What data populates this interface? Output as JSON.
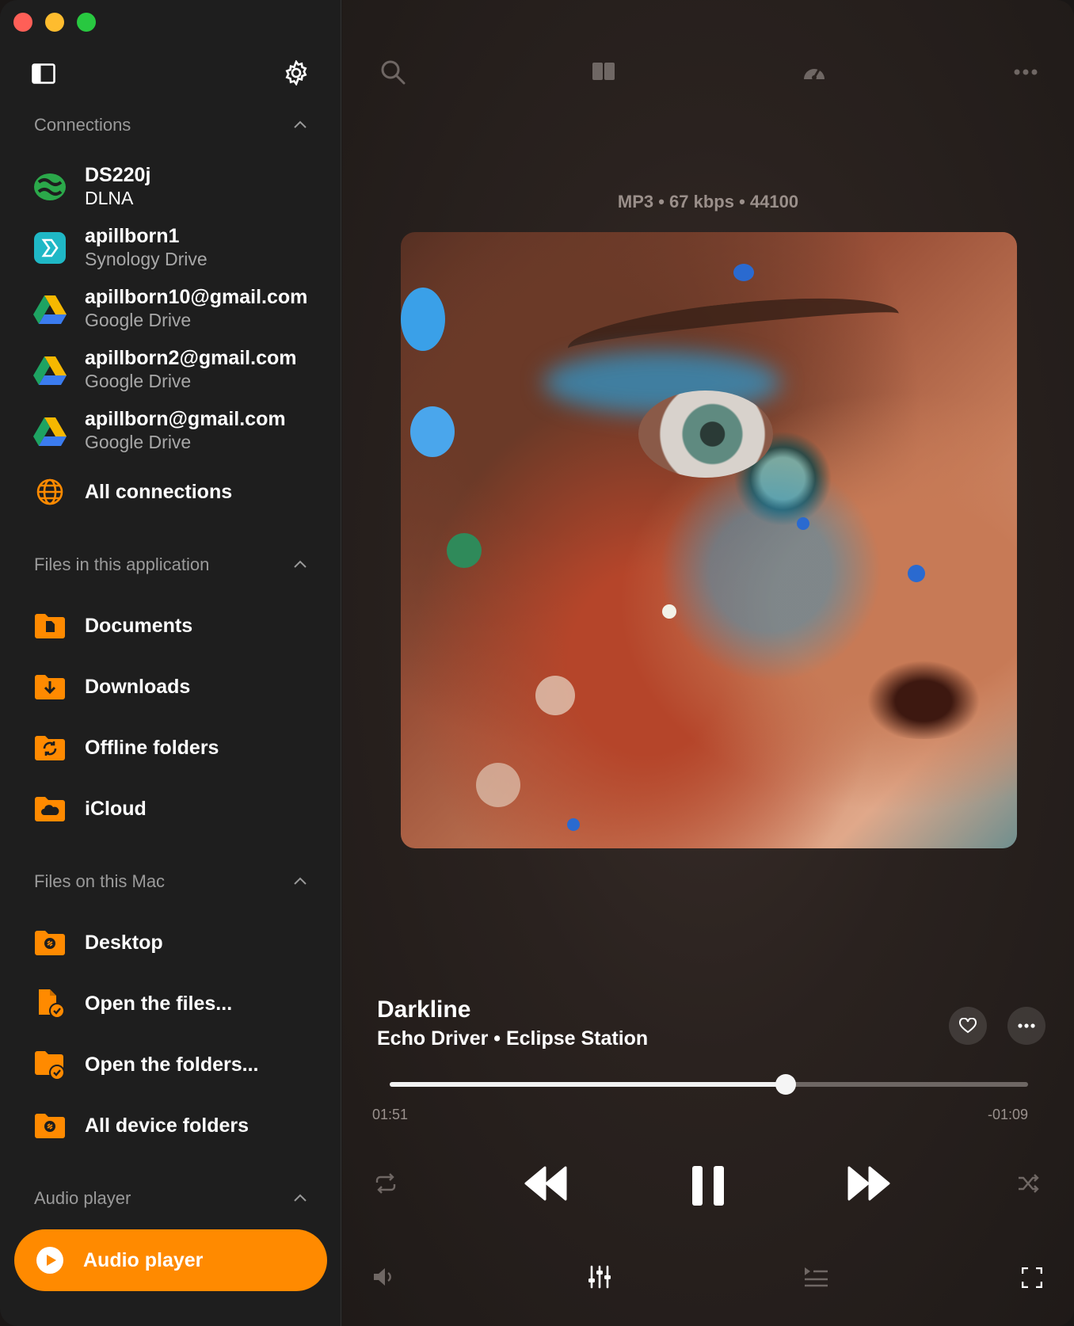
{
  "sidebar": {
    "sections": {
      "connections": "Connections",
      "files_app": "Files in this application",
      "files_mac": "Files on this Mac",
      "audio_player": "Audio player"
    },
    "connections": [
      {
        "title": "DS220j",
        "subtitle": "DLNA",
        "icon": "dlna-icon"
      },
      {
        "title": "apillborn1",
        "subtitle": "Synology Drive",
        "icon": "synology-drive-icon"
      },
      {
        "title": "apillborn10@gmail.com",
        "subtitle": "Google Drive",
        "icon": "google-drive-icon"
      },
      {
        "title": "apillborn2@gmail.com",
        "subtitle": "Google Drive",
        "icon": "google-drive-icon"
      },
      {
        "title": "apillborn@gmail.com",
        "subtitle": "Google Drive",
        "icon": "google-drive-icon"
      }
    ],
    "all_connections": "All connections",
    "app_files": [
      {
        "label": "Documents",
        "icon": "documents-folder-icon"
      },
      {
        "label": "Downloads",
        "icon": "downloads-folder-icon"
      },
      {
        "label": "Offline folders",
        "icon": "offline-folder-icon"
      },
      {
        "label": "iCloud",
        "icon": "icloud-folder-icon"
      }
    ],
    "mac_files": [
      {
        "label": "Desktop",
        "icon": "desktop-folder-icon"
      },
      {
        "label": "Open the files...",
        "icon": "open-file-icon"
      },
      {
        "label": "Open the folders...",
        "icon": "open-folder-icon"
      },
      {
        "label": "All device folders",
        "icon": "device-folder-icon"
      }
    ],
    "audio_player_button": "Audio player",
    "accent_color": "#ff8a00"
  },
  "player": {
    "format": "MP3 • 67 kbps • 44100",
    "title": "Darkline",
    "subtitle": "Echo Driver • Eclipse Station",
    "elapsed": "01:51",
    "remaining": "-01:09",
    "progress": 0.62
  }
}
